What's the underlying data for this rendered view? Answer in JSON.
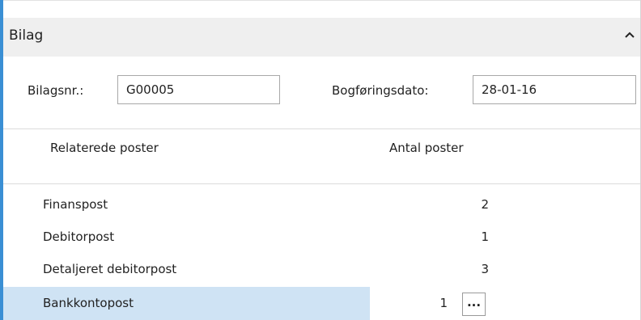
{
  "section": {
    "title": "Bilag"
  },
  "fields": {
    "document_no_label": "Bilagsnr.:",
    "document_no_value": "G00005",
    "posting_date_label": "Bogføringsdato:",
    "posting_date_value": "28-01-16"
  },
  "table": {
    "columns": [
      "Relaterede poster",
      "Antal poster"
    ],
    "rows": [
      {
        "name": "Finanspost",
        "count": "2"
      },
      {
        "name": "Debitorpost",
        "count": "1"
      },
      {
        "name": "Detaljeret debitorpost",
        "count": "3"
      },
      {
        "name": "Bankkontopost",
        "count": "1"
      }
    ],
    "lookup_label": "..."
  },
  "icons": {
    "collapse": "chevron-up-icon"
  },
  "colors": {
    "accent_border": "#3a8fd4",
    "selected_row": "#cfe3f4",
    "header_bg": "#efefef"
  }
}
